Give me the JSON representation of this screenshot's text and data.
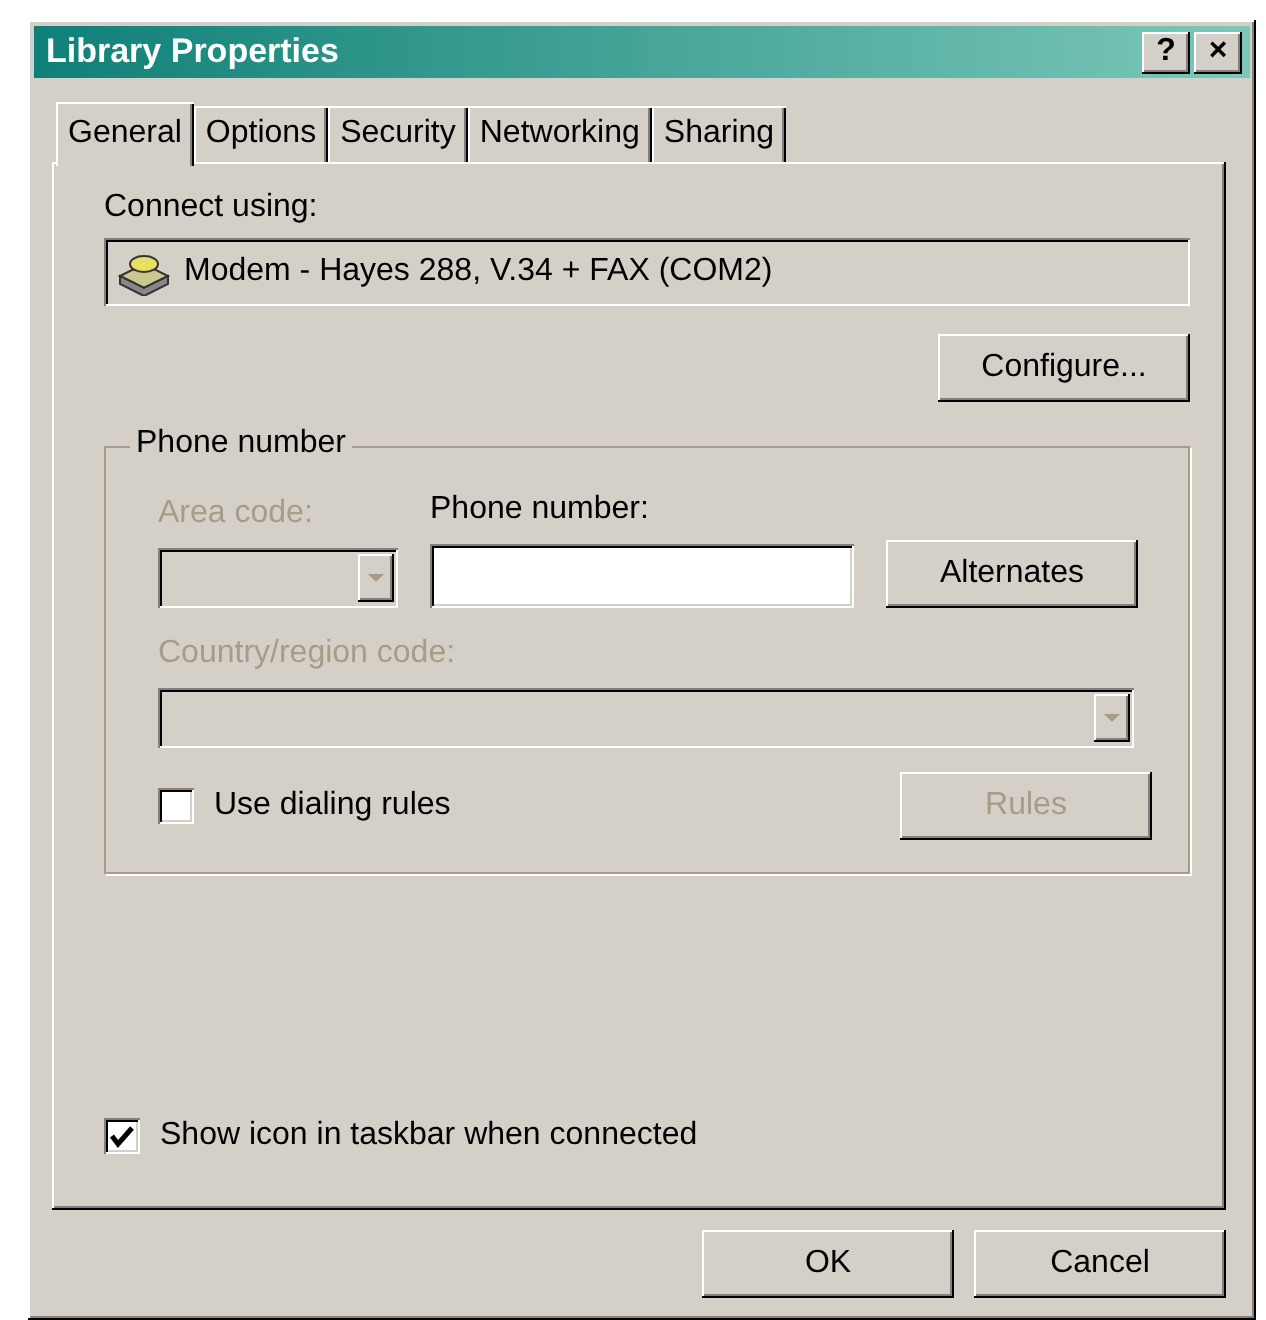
{
  "window": {
    "title": "Library Properties",
    "title_buttons": [
      "?",
      "×"
    ]
  },
  "tabs": [
    {
      "label": "General",
      "selected": true
    },
    {
      "label": "Options",
      "selected": false
    },
    {
      "label": "Security",
      "selected": false
    },
    {
      "label": "Networking",
      "selected": false
    },
    {
      "label": "Sharing",
      "selected": false
    }
  ],
  "connect_using": {
    "label": "Connect using:",
    "device": "Modem - Hayes 288, V.34 + FAX (COM2)"
  },
  "configure_button": {
    "label": "Configure...",
    "disabled": false
  },
  "phone_group": {
    "title": "Phone number",
    "area_code": {
      "label": "Area code:",
      "disabled": true
    },
    "phone_number": {
      "label": "Phone number:",
      "disabled": false
    },
    "alternates_button": {
      "label": "Alternates",
      "disabled": false
    },
    "country_code": {
      "label": "Country/region code:",
      "disabled": true
    },
    "use_dialing_rules": {
      "label": "Use dialing rules",
      "checked": false
    },
    "rules_button": {
      "label": "Rules",
      "disabled": true
    }
  },
  "show_icon": {
    "label": "Show icon in taskbar when connected",
    "checked": true
  },
  "buttons": [
    {
      "label": "OK",
      "disabled": false
    },
    {
      "label": "Cancel",
      "disabled": false
    }
  ]
}
